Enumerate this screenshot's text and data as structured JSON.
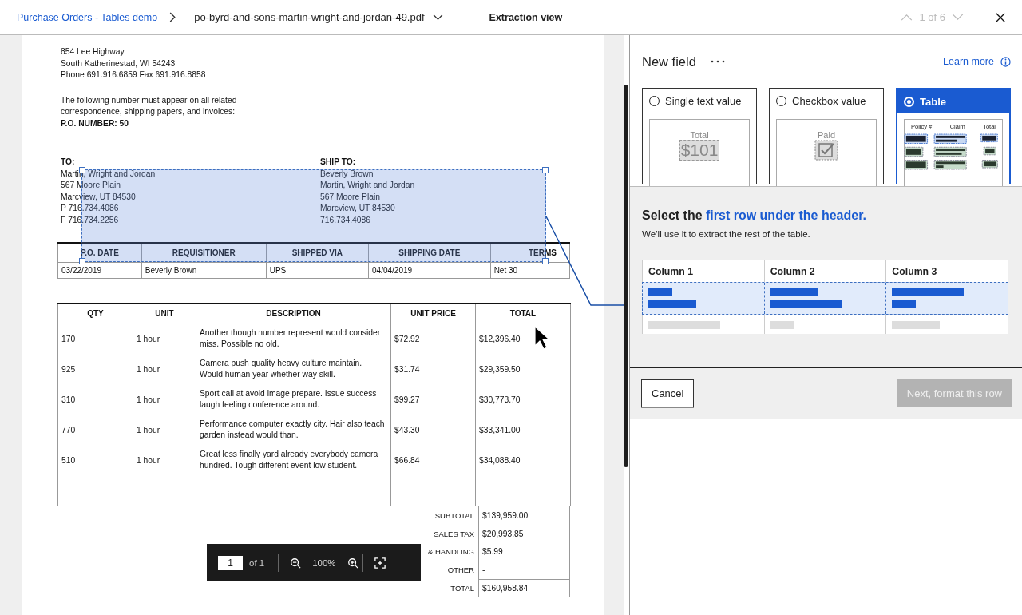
{
  "header": {
    "breadcrumb": "Purchase Orders - Tables demo",
    "file": "po-byrd-and-sons-martin-wright-and-jordan-49.pdf",
    "view_title": "Extraction view",
    "pager": "1 of 6"
  },
  "document": {
    "address_lines": [
      "854 Lee Highway",
      "South Katherinestad, WI 54243",
      "Phone 691.916.6859  Fax 691.916.8858"
    ],
    "notice_lines": [
      "The following number must appear on all related",
      "correspondence, shipping papers, and invoices:"
    ],
    "po_number": "P.O. NUMBER: 50",
    "to": {
      "label": "TO:",
      "lines": [
        "Martin, Wright and Jordan",
        "567 Moore Plain",
        "Marcview, UT 84530",
        "P 716.734.4086",
        "F 716.734.2256"
      ]
    },
    "ship_to": {
      "label": "SHIP TO:",
      "lines": [
        "Beverly Brown",
        "Martin, Wright and Jordan",
        "567 Moore Plain",
        "Marcview, UT 84530",
        "716.734.4086"
      ]
    },
    "order_table": {
      "columns": [
        "P.O. DATE",
        "REQUISITIONER",
        "SHIPPED VIA",
        "SHIPPING DATE",
        "TERMS"
      ],
      "row": [
        "03/22/2019",
        "Beverly Brown",
        "UPS",
        "04/04/2019",
        "Net 30"
      ]
    },
    "items_table": {
      "columns": [
        "QTY",
        "UNIT",
        "DESCRIPTION",
        "UNIT PRICE",
        "TOTAL"
      ],
      "rows": [
        {
          "qty": "170",
          "unit": "1 hour",
          "description": "Another though number represent would consider miss. Possible no old.",
          "unit_price": "$72.92",
          "total": "$12,396.40"
        },
        {
          "qty": "925",
          "unit": "1 hour",
          "description": "Camera push quality heavy culture maintain. Would human year whether way skill.",
          "unit_price": "$31.74",
          "total": "$29,359.50"
        },
        {
          "qty": "310",
          "unit": "1 hour",
          "description": "Sport call at avoid image prepare. Issue success laugh feeling conference around.",
          "unit_price": "$99.27",
          "total": "$30,773.70"
        },
        {
          "qty": "770",
          "unit": "1 hour",
          "description": "Performance computer exactly city. Hair also teach garden instead would than.",
          "unit_price": "$43.30",
          "total": "$33,341.00"
        },
        {
          "qty": "510",
          "unit": "1 hour",
          "description": "Great less finally yard already everybody camera hundred. Tough different event low student.",
          "unit_price": "$66.84",
          "total": "$34,088.40"
        }
      ]
    },
    "totals": [
      {
        "label": "SUBTOTAL",
        "value": "$139,959.00"
      },
      {
        "label": "SALES TAX",
        "value": "$20,993.85"
      },
      {
        "label": "& HANDLING",
        "value": "$5.99"
      },
      {
        "label": "OTHER",
        "value": "-"
      },
      {
        "label": "TOTAL",
        "value": "$160,958.84"
      }
    ],
    "page_toolbar": {
      "page": "1",
      "of": "of 1",
      "zoom": "100%"
    }
  },
  "panel": {
    "title": "New field",
    "learn_more": "Learn more",
    "options": [
      {
        "kind": "text",
        "label": "Single text value",
        "selected": false,
        "preview": [
          "Total",
          "$101"
        ]
      },
      {
        "kind": "checkbox",
        "label": "Checkbox value",
        "selected": false,
        "preview": [
          "Paid"
        ]
      },
      {
        "kind": "table",
        "label": "Table",
        "selected": true,
        "preview": [
          "Policy #",
          "Claim",
          "Total"
        ]
      }
    ],
    "prompt": "Select the **first row under the header.**",
    "subtext": "We’ll use it to extract the rest of the table.",
    "columns": [
      "Column 1",
      "Column 2",
      "Column 3"
    ],
    "cancel": "Cancel",
    "next": {
      "label": "Next, format this row",
      "disabled": true
    }
  }
}
